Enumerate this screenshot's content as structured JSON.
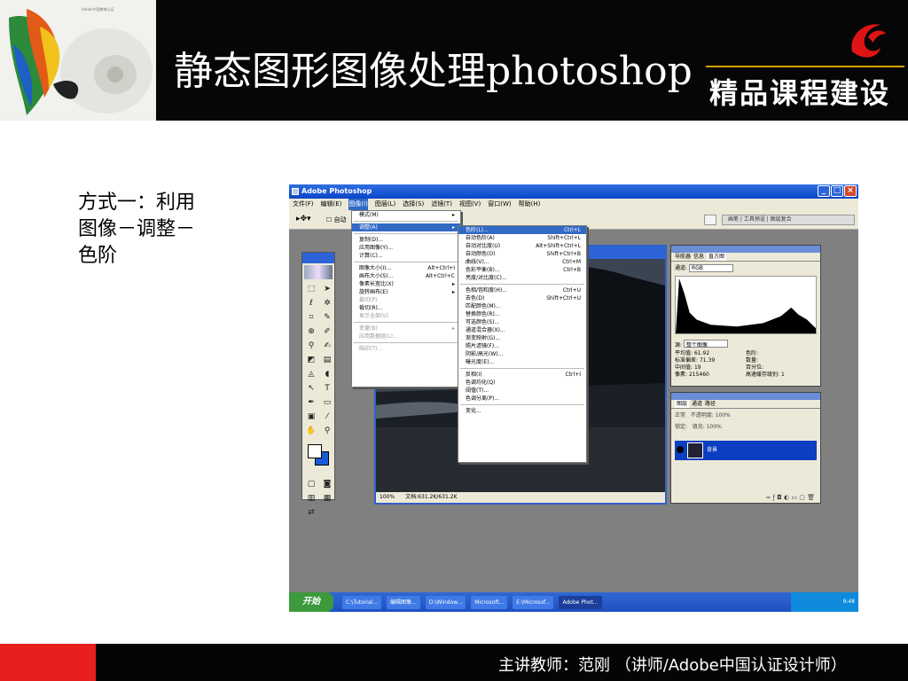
{
  "header": {
    "title": "静态图形图像处理photoshop",
    "brand": "精品课程建设",
    "logo_fine_print": "Adobe中国教育认证",
    "colors": {
      "banner": "#060606",
      "brand_mark": "#e01414",
      "footer_accent": "#e81f1f"
    }
  },
  "side_text": {
    "lines": [
      "方式一：利用",
      "图像－调整－",
      "色阶"
    ]
  },
  "screenshot": {
    "window_title": "Adobe Photoshop",
    "menubar": [
      "文件(F)",
      "编辑(E)",
      "图像(I)",
      "图层(L)",
      "选择(S)",
      "滤镜(T)",
      "视图(V)",
      "窗口(W)",
      "帮助(H)"
    ],
    "active_menu": "图像(I)",
    "image_menu": [
      {
        "label": "模式(M)",
        "shortcut": ""
      },
      {
        "label": "调整(A)",
        "shortcut": "",
        "highlight": true
      },
      {
        "label": "复制(D)...",
        "shortcut": ""
      },
      {
        "label": "应用图像(Y)...",
        "shortcut": ""
      },
      {
        "label": "计算(C)...",
        "shortcut": ""
      },
      {
        "label": "图像大小(I)...",
        "shortcut": "Alt+Ctrl+I"
      },
      {
        "label": "画布大小(S)...",
        "shortcut": "Alt+Ctrl+C"
      },
      {
        "label": "像素长宽比(X)",
        "shortcut": ""
      },
      {
        "label": "旋转画布(E)",
        "shortcut": ""
      },
      {
        "label": "裁切(P)",
        "shortcut": "",
        "disabled": true
      },
      {
        "label": "裁切(R)...",
        "shortcut": ""
      },
      {
        "label": "显示全部(V)",
        "shortcut": "",
        "disabled": true
      },
      {
        "label": "变量(B)",
        "shortcut": "",
        "disabled": true
      },
      {
        "label": "应用数据组(L)...",
        "shortcut": "",
        "disabled": true
      },
      {
        "label": "陷印(T)...",
        "shortcut": "",
        "disabled": true
      }
    ],
    "adjust_menu": [
      {
        "label": "色阶(L)...",
        "shortcut": "Ctrl+L",
        "highlight": true
      },
      {
        "label": "自动色阶(A)",
        "shortcut": "Shift+Ctrl+L"
      },
      {
        "label": "自动对比度(U)",
        "shortcut": "Alt+Shift+Ctrl+L"
      },
      {
        "label": "自动颜色(O)",
        "shortcut": "Shift+Ctrl+B"
      },
      {
        "label": "曲线(V)...",
        "shortcut": "Ctrl+M"
      },
      {
        "label": "色彩平衡(B)...",
        "shortcut": "Ctrl+B"
      },
      {
        "label": "亮度/对比度(C)...",
        "shortcut": ""
      },
      {
        "label": "色相/饱和度(H)...",
        "shortcut": "Ctrl+U"
      },
      {
        "label": "去色(D)",
        "shortcut": "Shift+Ctrl+U"
      },
      {
        "label": "匹配颜色(M)...",
        "shortcut": ""
      },
      {
        "label": "替换颜色(R)...",
        "shortcut": ""
      },
      {
        "label": "可选颜色(S)...",
        "shortcut": ""
      },
      {
        "label": "通道混合器(X)...",
        "shortcut": ""
      },
      {
        "label": "渐变映射(G)...",
        "shortcut": ""
      },
      {
        "label": "照片滤镜(F)...",
        "shortcut": ""
      },
      {
        "label": "阴影/高光(W)...",
        "shortcut": ""
      },
      {
        "label": "曝光度(E)...",
        "shortcut": ""
      },
      {
        "label": "反相(I)",
        "shortcut": "Ctrl+I"
      },
      {
        "label": "色调均化(Q)",
        "shortcut": ""
      },
      {
        "label": "阈值(T)...",
        "shortcut": ""
      },
      {
        "label": "色调分离(P)...",
        "shortcut": ""
      },
      {
        "label": "变化...",
        "shortcut": ""
      }
    ],
    "doc_status": {
      "zoom": "100%",
      "file_info": "文档:631.2K/631.2K"
    },
    "histogram": {
      "tabs": [
        "导航器",
        "信息",
        "直方图"
      ],
      "active_tab": "直方图",
      "channel_label": "通道:",
      "channel_value": "RGB",
      "source_label": "源:",
      "source_value": "整个图像",
      "stats": [
        {
          "label": "平均值:",
          "value": "61.92"
        },
        {
          "label": "色阶:",
          "value": ""
        },
        {
          "label": "标准偏差:",
          "value": "71.39"
        },
        {
          "label": "数量:",
          "value": ""
        },
        {
          "label": "中间值:",
          "value": "19"
        },
        {
          "label": "百分位:",
          "value": ""
        },
        {
          "label": "像素:",
          "value": "215460"
        },
        {
          "label": "高速缓存级别:",
          "value": "1"
        }
      ]
    },
    "layers": {
      "tabs": [
        "图层",
        "通道",
        "路径"
      ],
      "active_tab": "图层",
      "blend": "正常",
      "opacity": "不透明度: 100%",
      "fill": "填充: 100%",
      "lock": "锁定:",
      "layer_name": "背景"
    },
    "taskbar": {
      "start": "开始",
      "tasks": [
        "C:\\Tutorial...",
        "编辑图像...",
        "D:\\Window...",
        "Microsoft...",
        "E:\\Microsof...",
        "Adobe Phot..."
      ],
      "active_task_index": 5,
      "clock": "9:48"
    }
  },
  "footer": {
    "text": "主讲教师：范刚  （讲师/Adobe中国认证设计师）"
  }
}
